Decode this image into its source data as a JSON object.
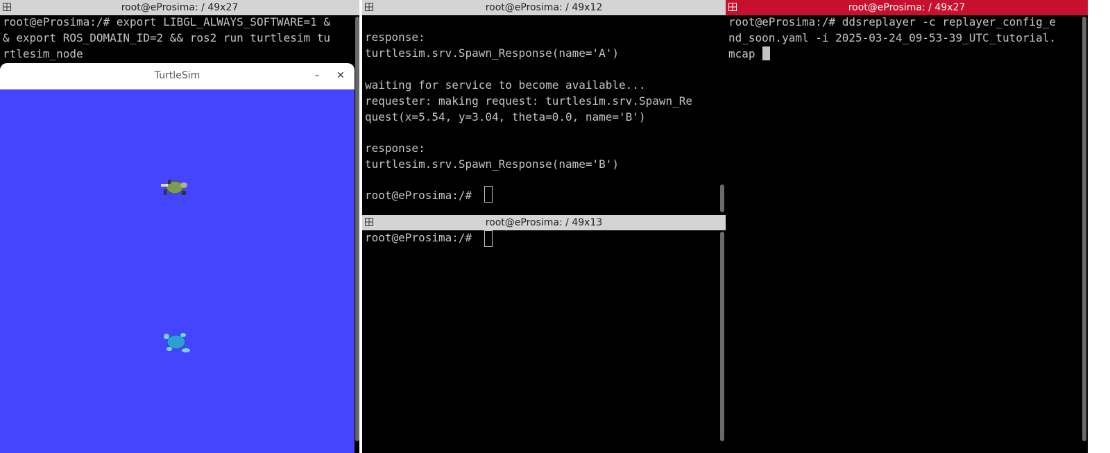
{
  "left_terminal": {
    "title": "root@eProsima: / 49x27",
    "lines": [
      "root@eProsima:/# export LIBGL_ALWAYS_SOFTWARE=1 &",
      "& export ROS_DOMAIN_ID=2 && ros2 run turtlesim tu",
      "rtlesim_node"
    ]
  },
  "turtlesim_window": {
    "title": "TurtleSim",
    "minimize_glyph": "–",
    "close_glyph": "✕",
    "background_color": "#4545ff",
    "turtles": [
      {
        "name": "turtle-green-icon",
        "color": "#7a9a55"
      },
      {
        "name": "turtle-blue-icon",
        "color": "#2e9fd6"
      }
    ]
  },
  "middle_top_terminal": {
    "title": "root@eProsima: / 49x12",
    "lines": [
      "",
      "response:",
      "turtlesim.srv.Spawn_Response(name='A')",
      "",
      "waiting for service to become available...",
      "requester: making request: turtlesim.srv.Spawn_Re",
      "quest(x=5.54, y=3.04, theta=0.0, name='B')",
      "",
      "response:",
      "turtlesim.srv.Spawn_Response(name='B')",
      "",
      "root@eProsima:/# "
    ]
  },
  "middle_bottom_terminal": {
    "title": "root@eProsima: / 49x13",
    "lines": [
      "root@eProsima:/# "
    ]
  },
  "right_terminal": {
    "title": "root@eProsima: / 49x27",
    "lines": [
      "root@eProsima:/# ddsreplayer -c replayer_config_e",
      "nd_soon.yaml -i 2025-03-24_09-53-39_UTC_tutorial.",
      "mcap "
    ]
  },
  "colors": {
    "active_title": "#c8102e",
    "inactive_title": "#d4d4d4",
    "terminal_text": "#c4c4c4"
  }
}
